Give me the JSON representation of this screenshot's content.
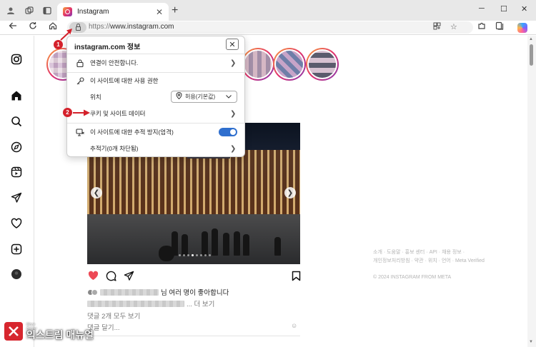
{
  "browser": {
    "tab_title": "Instagram",
    "url_scheme": "https://",
    "url_host": "www.instagram.com",
    "tab_close": "✕",
    "new_tab": "+",
    "window_controls": [
      "─",
      "☐",
      "✕"
    ]
  },
  "popup": {
    "title": "instagram.com 정보",
    "close": "✕",
    "connection": "연결이 안전합니다.",
    "permissions_header": "이 사이트에 대한 사용 권한",
    "location_label": "위치",
    "location_value": "허용(기본값)",
    "cookies": "쿠키 및 사이트 데이터",
    "tracking_header": "이 사이트에 대한 추적 방지(엄격)",
    "trackers": "추적기(0개 차단됨)",
    "tracking_toggle_on": true
  },
  "annotations": {
    "step1": "1",
    "step2": "2",
    "color": "#d4212b"
  },
  "post": {
    "liked_by_suffix": "님 여러 명이 좋아합니다",
    "more": "... 더 보기",
    "view_all_comments": "댓글 2개 모두 보기",
    "add_comment": "댓글 달기...",
    "emoji": "☺",
    "carousel_dots": 8,
    "active_dot": 3,
    "liked": true,
    "like_color": "#ed4956"
  },
  "footer": {
    "links_line1": "소개 · 도움말 · 홍보 센터 · API · 채용 정보 ·",
    "links_line2": "개인정보처리방침 · 약관 · 위치 · 언어 · Meta Verified",
    "copyright": "© 2024 INSTAGRAM FROM META"
  },
  "sidebar_icons": [
    "instagram-logo-icon",
    "home-icon",
    "search-icon",
    "explore-icon",
    "reels-icon",
    "messages-icon",
    "notifications-icon",
    "create-icon",
    "profile-icon"
  ],
  "watermark": {
    "subtitle": "More Better IT Life",
    "title": "익스트림 매뉴얼"
  }
}
